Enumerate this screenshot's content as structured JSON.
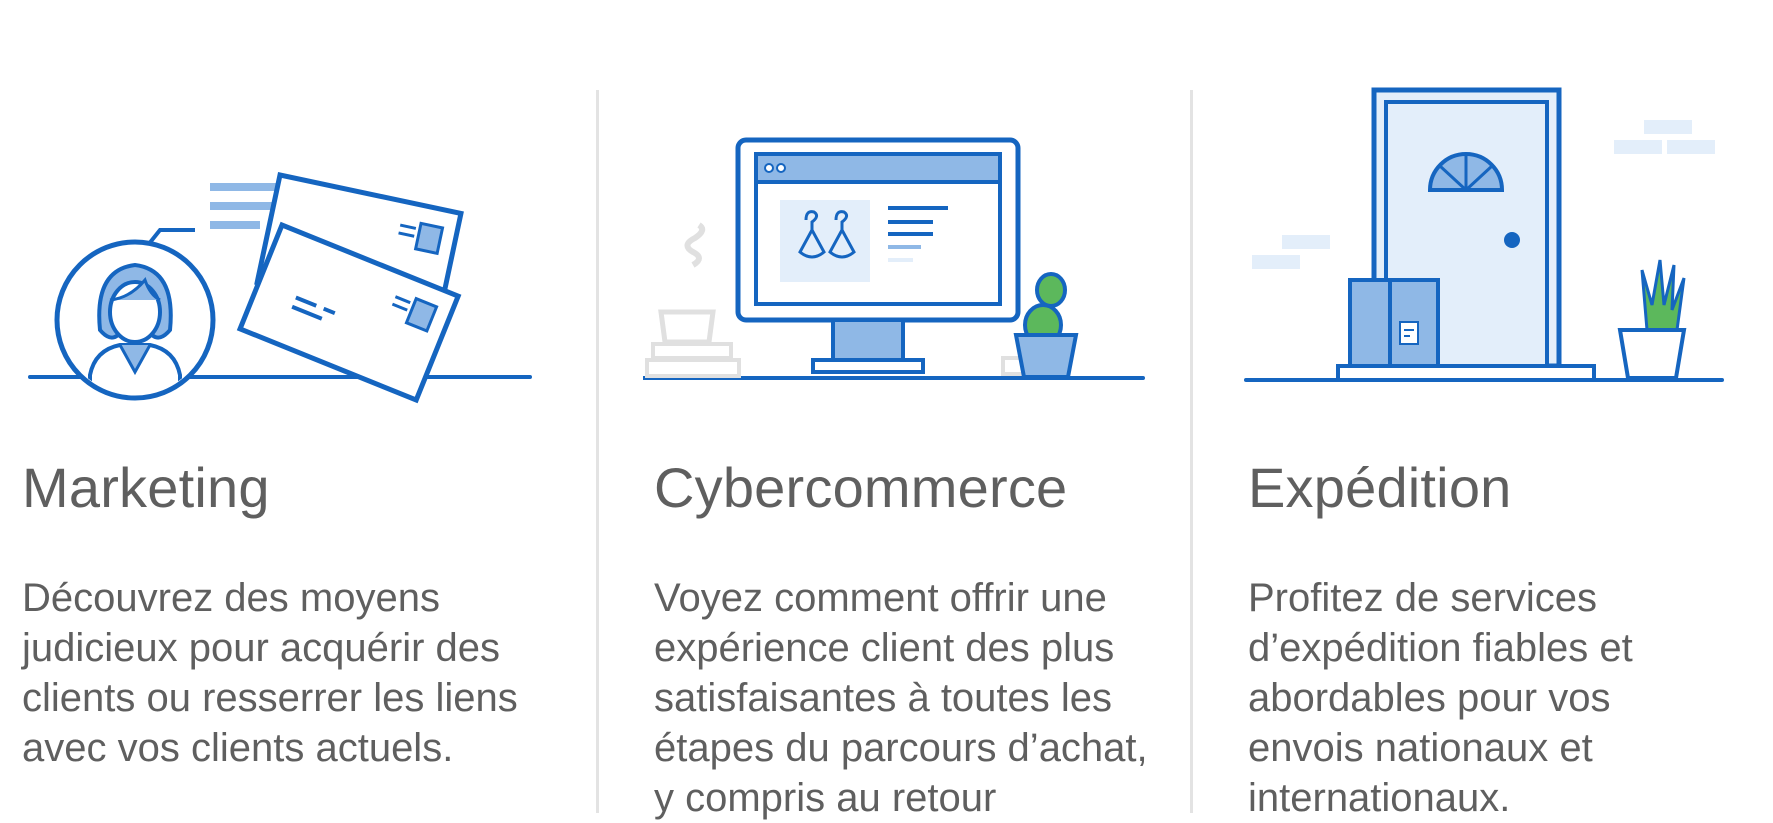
{
  "colors": {
    "primary_blue": "#1565c0",
    "light_blue": "#e3eefa",
    "mid_blue": "#8fb8e6",
    "green": "#5cb85c",
    "grey_line": "#e3e3e3",
    "text": "#5f5f5f"
  },
  "cards": [
    {
      "icon": "marketing-illustration-icon",
      "title": "Marketing",
      "description": "Découvrez des moyens judicieux pour acquérir des clients ou resserrer les liens avec vos clients actuels."
    },
    {
      "icon": "ecommerce-illustration-icon",
      "title": "Cybercommerce",
      "description": "Voyez comment offrir une expérience client des plus satisfaisantes à toutes les étapes du parcours d’ach­at, y compris au retour"
    },
    {
      "icon": "shipping-illustration-icon",
      "title": "Expédition",
      "description": "Profitez de services d’expédition fiables et abordables pour vos envois nationaux et internationaux."
    }
  ]
}
